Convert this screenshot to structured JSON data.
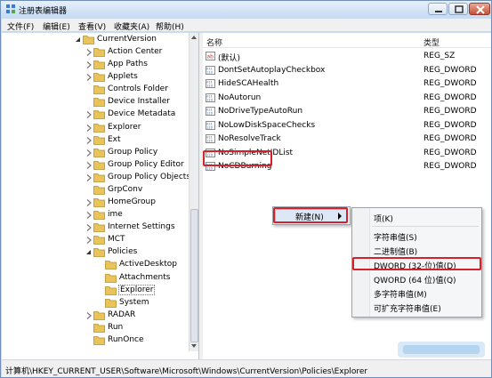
{
  "window": {
    "title": "注册表编辑器"
  },
  "menu": {
    "items": [
      "文件(F)",
      "编辑(E)",
      "查看(V)",
      "收藏夹(A)",
      "帮助(H)"
    ]
  },
  "tree": {
    "items": [
      {
        "label": "CurrentVersion",
        "depth": 1,
        "expanded": true
      },
      {
        "label": "Action Center",
        "depth": 2,
        "expanded": false
      },
      {
        "label": "App Paths",
        "depth": 2,
        "expanded": false
      },
      {
        "label": "Applets",
        "depth": 2,
        "expanded": false
      },
      {
        "label": "Controls Folder",
        "depth": 2,
        "expanded": null
      },
      {
        "label": "Device Installer",
        "depth": 2,
        "expanded": null
      },
      {
        "label": "Device Metadata",
        "depth": 2,
        "expanded": false
      },
      {
        "label": "Explorer",
        "depth": 2,
        "expanded": false
      },
      {
        "label": "Ext",
        "depth": 2,
        "expanded": false
      },
      {
        "label": "Group Policy",
        "depth": 2,
        "expanded": false
      },
      {
        "label": "Group Policy Editor",
        "depth": 2,
        "expanded": false
      },
      {
        "label": "Group Policy Objects",
        "depth": 2,
        "expanded": false
      },
      {
        "label": "GrpConv",
        "depth": 2,
        "expanded": null
      },
      {
        "label": "HomeGroup",
        "depth": 2,
        "expanded": false
      },
      {
        "label": "ime",
        "depth": 2,
        "expanded": false
      },
      {
        "label": "Internet Settings",
        "depth": 2,
        "expanded": false
      },
      {
        "label": "MCT",
        "depth": 2,
        "expanded": false
      },
      {
        "label": "Policies",
        "depth": 2,
        "expanded": true
      },
      {
        "label": "ActiveDesktop",
        "depth": 3,
        "expanded": null
      },
      {
        "label": "Attachments",
        "depth": 3,
        "expanded": null
      },
      {
        "label": "Explorer",
        "depth": 3,
        "expanded": null,
        "selected": true
      },
      {
        "label": "System",
        "depth": 3,
        "expanded": null
      },
      {
        "label": "RADAR",
        "depth": 2,
        "expanded": false
      },
      {
        "label": "Run",
        "depth": 2,
        "expanded": null
      },
      {
        "label": "RunOnce",
        "depth": 2,
        "expanded": null
      }
    ]
  },
  "list": {
    "col_name": "名称",
    "col_type": "类型",
    "values": [
      {
        "name": "(默认)",
        "type": "REG_SZ",
        "icon": "string-value-icon"
      },
      {
        "name": "DontSetAutoplayCheckbox",
        "type": "REG_DWORD",
        "icon": "binary-value-icon"
      },
      {
        "name": "HideSCAHealth",
        "type": "REG_DWORD",
        "icon": "binary-value-icon"
      },
      {
        "name": "NoAutorun",
        "type": "REG_DWORD",
        "icon": "binary-value-icon"
      },
      {
        "name": "NoDriveTypeAutoRun",
        "type": "REG_DWORD",
        "icon": "binary-value-icon"
      },
      {
        "name": "NoLowDiskSpaceChecks",
        "type": "REG_DWORD",
        "icon": "binary-value-icon"
      },
      {
        "name": "NoResolveTrack",
        "type": "REG_DWORD",
        "icon": "binary-value-icon"
      },
      {
        "name": "NoSimpleNetIDList",
        "type": "REG_DWORD",
        "icon": "binary-value-icon"
      },
      {
        "name": "NoCDBurning",
        "type": "REG_DWORD",
        "icon": "binary-value-icon"
      }
    ]
  },
  "context_menu": {
    "new_label": "新建(N)"
  },
  "submenu": {
    "items": [
      "项(K)",
      "字符串值(S)",
      "二进制值(B)",
      "DWORD (32-位)值(D)",
      "QWORD (64 位)值(Q)",
      "多字符串值(M)",
      "可扩充字符串值(E)"
    ]
  },
  "status": {
    "path": "计算机\\HKEY_CURRENT_USER\\Software\\Microsoft\\Windows\\CurrentVersion\\Policies\\Explorer"
  },
  "colors": {
    "highlight_box": "#d8202a",
    "folder": "#e8c45a",
    "title_gradient_top": "#e6f0fb",
    "title_gradient_bottom": "#c6daf2"
  }
}
